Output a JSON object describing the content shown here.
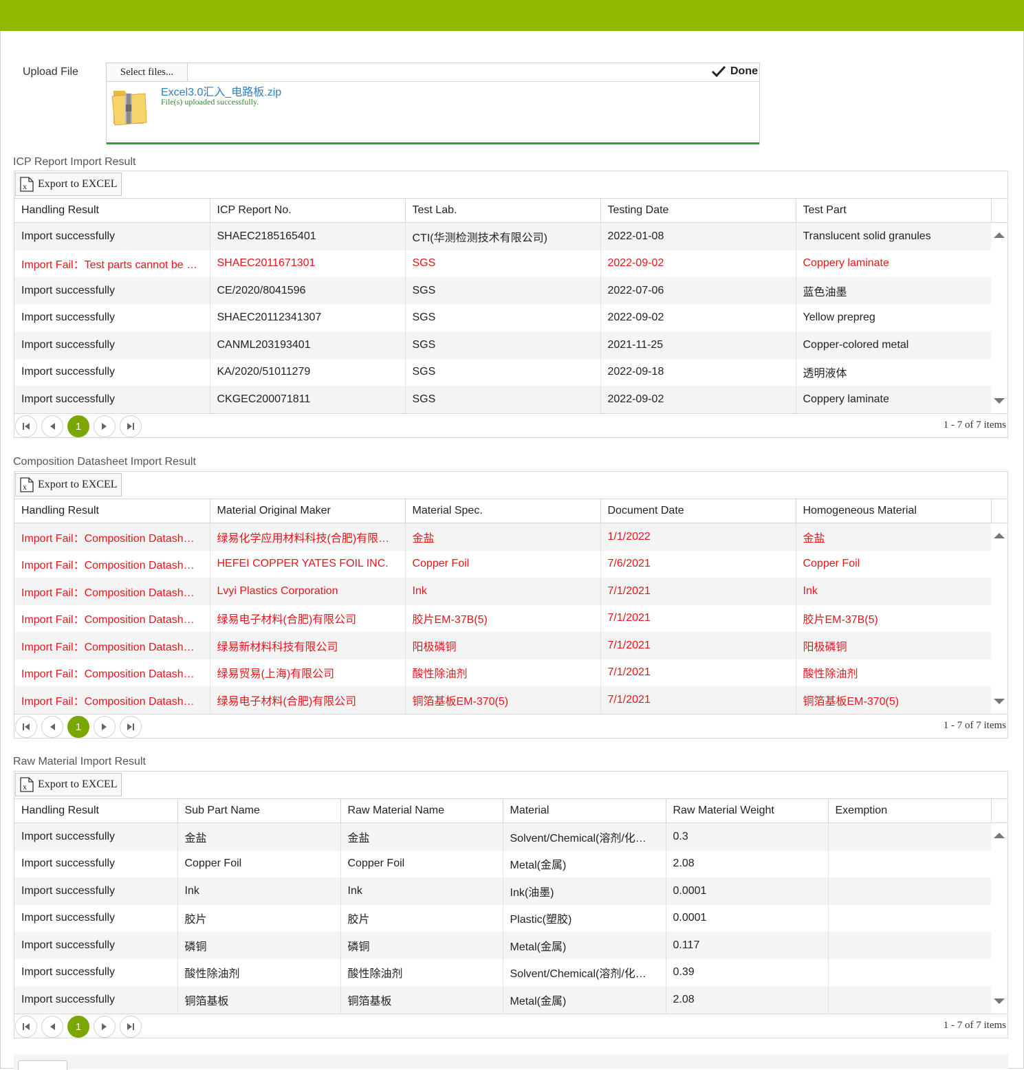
{
  "upload": {
    "label": "Upload File",
    "select_label": "Select files...",
    "done_label": "Done",
    "file_name": "Excel3.0汇入_电路板.zip",
    "file_status": "File(s) uploaded successfully."
  },
  "export_label": "Export to EXCEL",
  "icp": {
    "title": "ICP Report Import Result",
    "columns": [
      "Handling Result",
      "ICP Report No.",
      "Test Lab.",
      "Testing Date",
      "Test Part"
    ],
    "rows": [
      {
        "fail": false,
        "cells": [
          "Import successfully",
          "SHAEC2185165401",
          "CTI(华测检测技术有限公司)",
          "2022-01-08",
          "Translucent solid granules"
        ]
      },
      {
        "fail": true,
        "cells": [
          "Import Fail：Test parts cannot be …",
          "SHAEC2011671301",
          "SGS",
          "2022-09-02",
          "Coppery laminate"
        ]
      },
      {
        "fail": false,
        "cells": [
          "Import successfully",
          "CE/2020/8041596",
          "SGS",
          "2022-07-06",
          "蓝色油墨"
        ]
      },
      {
        "fail": false,
        "cells": [
          "Import successfully",
          "SHAEC20112341307",
          "SGS",
          "2022-09-02",
          "Yellow prepreg"
        ]
      },
      {
        "fail": false,
        "cells": [
          "Import successfully",
          "CANML203193401",
          "SGS",
          "2021-11-25",
          "Copper-colored metal"
        ]
      },
      {
        "fail": false,
        "cells": [
          "Import successfully",
          "KA/2020/51011279",
          "SGS",
          "2022-09-18",
          "透明液体"
        ]
      },
      {
        "fail": false,
        "cells": [
          "Import successfully",
          "CKGEC200071811",
          "SGS",
          "2022-09-02",
          "Coppery laminate"
        ]
      }
    ],
    "page": "1",
    "page_info": "1 - 7 of 7 items"
  },
  "comp": {
    "title": "Composition Datasheet Import Result",
    "columns": [
      "Handling Result",
      "Material Original Maker",
      "Material Spec.",
      "Document Date",
      "Homogeneous Material"
    ],
    "rows": [
      {
        "fail": true,
        "cells": [
          "Import Fail：Composition Datash…",
          "绿易化学应用材料科技(合肥)有限…",
          "金盐",
          "1/1/2022",
          "金盐"
        ]
      },
      {
        "fail": true,
        "cells": [
          "Import Fail：Composition Datash…",
          "HEFEI COPPER YATES FOIL INC.",
          "Copper Foil",
          "7/6/2021",
          "Copper Foil"
        ]
      },
      {
        "fail": true,
        "cells": [
          "Import Fail：Composition Datash…",
          "Lvyi Plastics Corporation",
          "Ink",
          "7/1/2021",
          "Ink"
        ]
      },
      {
        "fail": true,
        "cells": [
          "Import Fail：Composition Datash…",
          "绿易电子材料(合肥)有限公司",
          "胶片EM-37B(5)",
          "7/1/2021",
          "胶片EM-37B(5)"
        ]
      },
      {
        "fail": true,
        "cells": [
          "Import Fail：Composition Datash…",
          "绿易新材料科技有限公司",
          "阳极磷铜",
          "7/1/2021",
          "阳极磷铜"
        ]
      },
      {
        "fail": true,
        "cells": [
          "Import Fail：Composition Datash…",
          "绿易贸易(上海)有限公司",
          "酸性除油剂",
          "7/1/2021",
          "酸性除油剂"
        ]
      },
      {
        "fail": true,
        "cells": [
          "Import Fail：Composition Datash…",
          "绿易电子材料(合肥)有限公司",
          "铜箔基板EM-370(5)",
          "7/1/2021",
          "铜箔基板EM-370(5)"
        ]
      }
    ],
    "page": "1",
    "page_info": "1 - 7 of 7 items"
  },
  "raw": {
    "title": "Raw Material Import Result",
    "columns": [
      "Handling Result",
      "Sub Part Name",
      "Raw Material Name",
      "Material",
      "Raw Material Weight",
      "Exemption"
    ],
    "rows": [
      {
        "fail": false,
        "cells": [
          "Import successfully",
          "金盐",
          "金盐",
          "Solvent/Chemical(溶剂/化…",
          "0.3",
          ""
        ]
      },
      {
        "fail": false,
        "cells": [
          "Import successfully",
          "Copper Foil",
          "Copper Foil",
          "Metal(金属)",
          "2.08",
          ""
        ]
      },
      {
        "fail": false,
        "cells": [
          "Import successfully",
          "Ink",
          "Ink",
          "Ink(油墨)",
          "0.0001",
          ""
        ]
      },
      {
        "fail": false,
        "cells": [
          "Import successfully",
          "胶片",
          "胶片",
          "Plastic(塑胶)",
          "0.0001",
          ""
        ]
      },
      {
        "fail": false,
        "cells": [
          "Import successfully",
          "磷铜",
          "磷铜",
          "Metal(金属)",
          "0.117",
          ""
        ]
      },
      {
        "fail": false,
        "cells": [
          "Import successfully",
          "酸性除油剂",
          "酸性除油剂",
          "Solvent/Chemical(溶剂/化…",
          "0.39",
          ""
        ]
      },
      {
        "fail": false,
        "cells": [
          "Import successfully",
          "铜箔基板",
          "铜箔基板",
          "Metal(金属)",
          "2.08",
          ""
        ]
      }
    ],
    "page": "1",
    "page_info": "1 - 7 of 7 items"
  },
  "colors": {
    "brand": "#8fb800",
    "fail": "#e8141a",
    "link": "#2f7fbf",
    "success": "#2e8b2e"
  }
}
